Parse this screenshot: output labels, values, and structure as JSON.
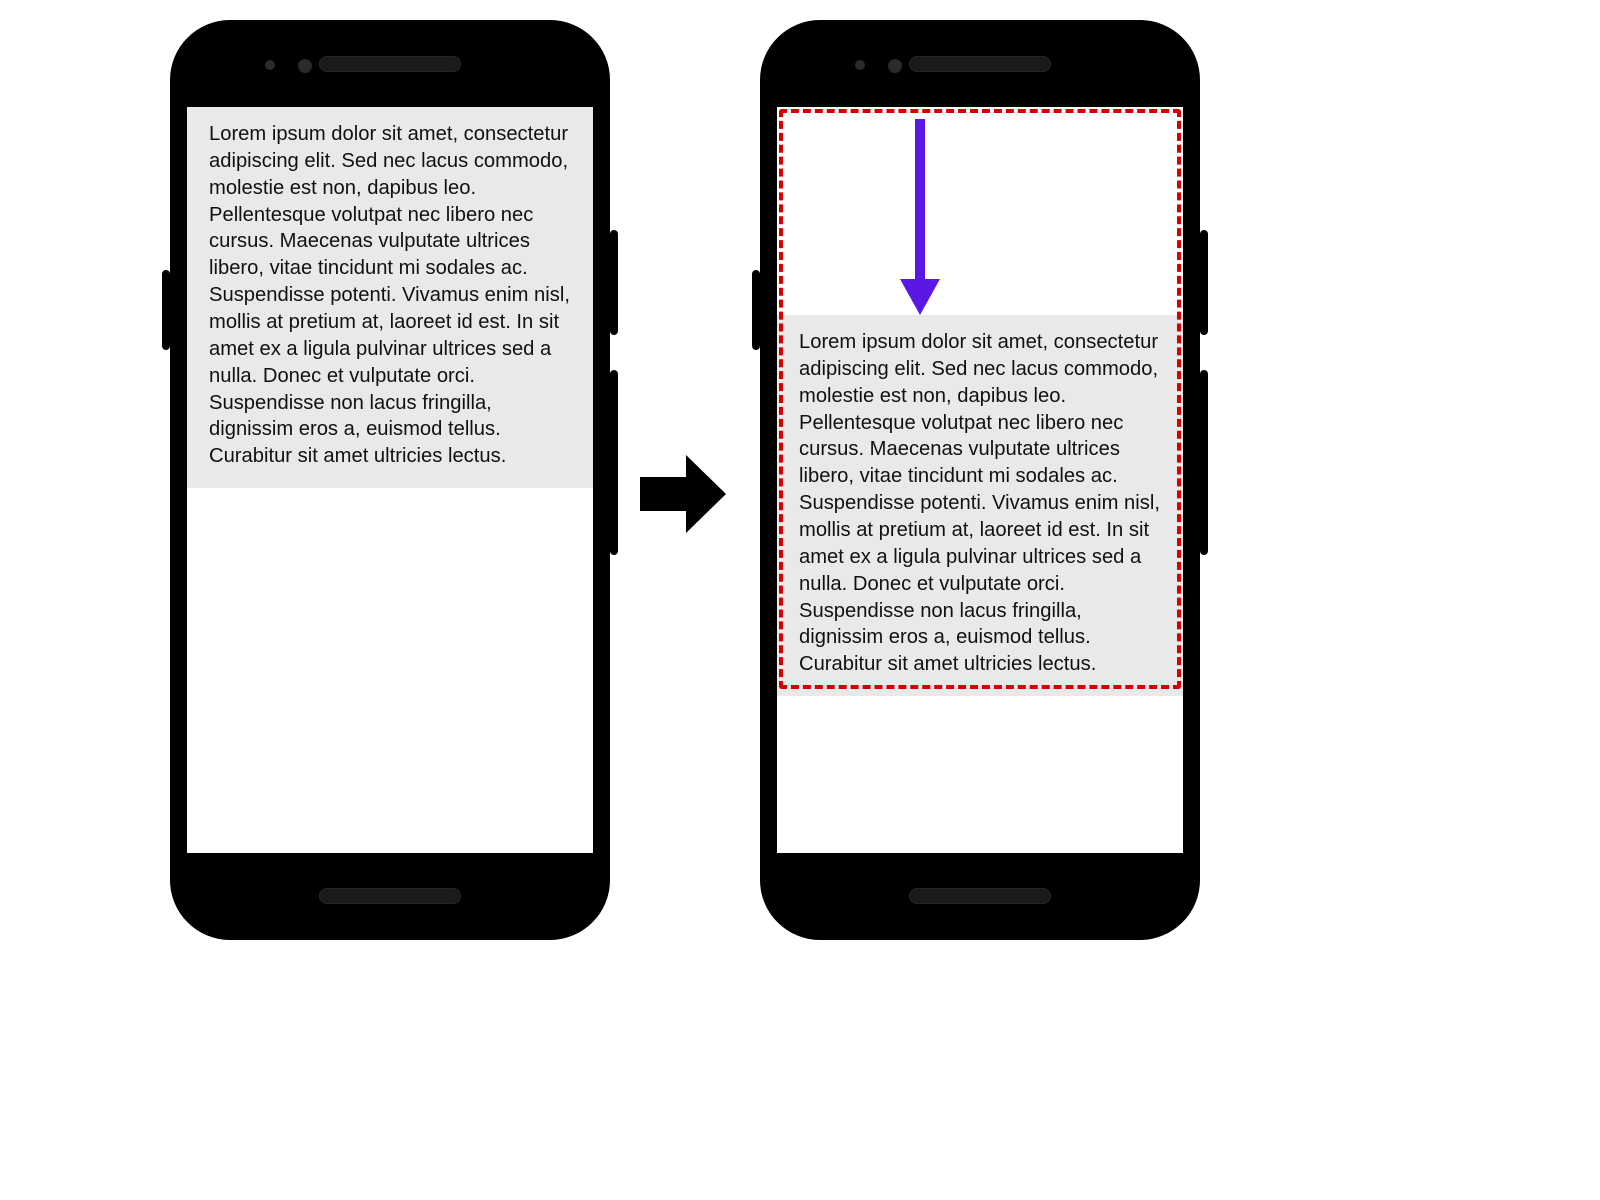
{
  "lorem_text": "Lorem ipsum dolor sit amet, consectetur adipiscing elit. Sed nec lacus commodo, molestie est non, dapibus leo. Pellentesque volutpat nec libero nec cursus. Maecenas vulputate ultrices libero, vitae tincidunt mi sodales ac. Suspendisse potenti. Vivamus enim nisl, mollis at pretium at, laoreet id est. In sit amet ex a ligula pulvinar ultrices sed a nulla. Donec et vulputate orci. Suspendisse non lacus fringilla, dignissim eros a, euismod tellus. Curabitur sit amet ultricies lectus.",
  "colors": {
    "text_block_bg": "#e9e9e9",
    "selection_border": "#d60000",
    "move_arrow": "#5a17e6",
    "transition_arrow": "#000000"
  }
}
